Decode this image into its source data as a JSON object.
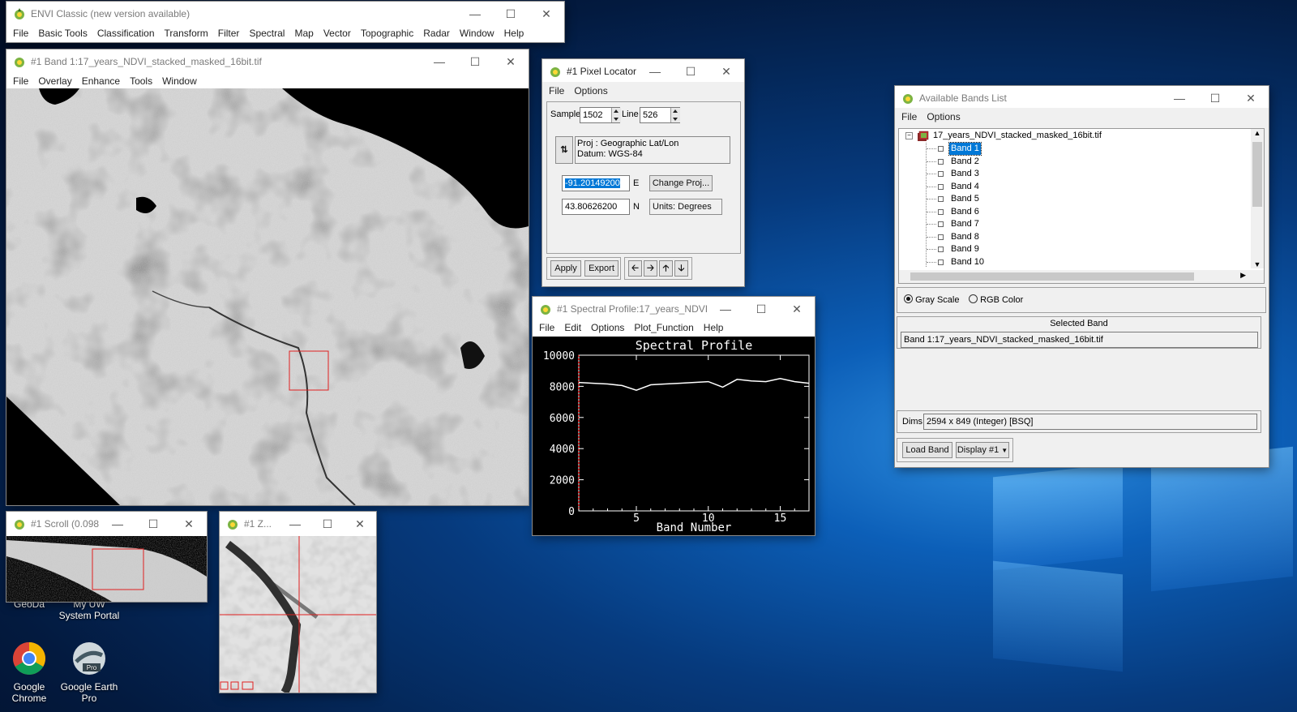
{
  "envi_main": {
    "title": "ENVI Classic (new version available)",
    "menu": [
      "File",
      "Basic Tools",
      "Classification",
      "Transform",
      "Filter",
      "Spectral",
      "Map",
      "Vector",
      "Topographic",
      "Radar",
      "Window",
      "Help"
    ]
  },
  "image_window": {
    "title": "#1 Band 1:17_years_NDVI_stacked_masked_16bit.tif",
    "menu": [
      "File",
      "Overlay",
      "Enhance",
      "Tools",
      "Window"
    ]
  },
  "pixel_locator": {
    "title": "#1 Pixel Locator",
    "menu": [
      "File",
      "Options"
    ],
    "sample_label": "Sample",
    "sample_value": "1502",
    "line_label": "Line",
    "line_value": "526",
    "proj_line1": "Proj : Geographic Lat/Lon",
    "proj_line2": "Datum: WGS-84",
    "easting_value": "-91.20149200",
    "easting_unit": "E",
    "northing_value": "43.80626200",
    "northing_unit": "N",
    "change_proj": "Change Proj...",
    "units": "Units: Degrees",
    "apply": "Apply",
    "export": "Export"
  },
  "spectral_profile": {
    "title": "#1 Spectral Profile:17_years_NDVI_...",
    "menu": [
      "File",
      "Edit",
      "Options",
      "Plot_Function",
      "Help"
    ]
  },
  "chart_data": {
    "type": "line",
    "title": "Spectral Profile",
    "xlabel": "Band Number",
    "ylabel": "",
    "x": [
      1,
      2,
      3,
      4,
      5,
      6,
      7,
      8,
      9,
      10,
      11,
      12,
      13,
      14,
      15,
      16,
      17
    ],
    "series": [
      {
        "values": [
          8250,
          8200,
          8150,
          8050,
          7750,
          8100,
          8150,
          8200,
          8250,
          8300,
          7950,
          8450,
          8350,
          8300,
          8500,
          8300,
          8200
        ]
      }
    ],
    "xlim": [
      1,
      17
    ],
    "ylim": [
      0,
      10000
    ],
    "xticks": [
      "5",
      "10",
      "15"
    ],
    "yticks": [
      "0",
      "2000",
      "4000",
      "6000",
      "8000",
      "10000"
    ],
    "colors": {
      "background": "#000000",
      "line": "#ffffff",
      "axis": "#ffffff",
      "left_marker": "#ff2020"
    }
  },
  "bands_list": {
    "title": "Available Bands List",
    "menu": [
      "File",
      "Options"
    ],
    "file_node": "17_years_NDVI_stacked_masked_16bit.tif",
    "bands": [
      "Band 1",
      "Band 2",
      "Band 3",
      "Band 4",
      "Band 5",
      "Band 6",
      "Band 7",
      "Band 8",
      "Band 9",
      "Band 10"
    ],
    "selected_index": 0,
    "gray_scale": "Gray Scale",
    "rgb_color": "RGB Color",
    "selected_band_header": "Selected Band",
    "selected_band_value": "Band 1:17_years_NDVI_stacked_masked_16bit.tif",
    "dims_label": "Dims",
    "dims_value": "2594 x 849 (Integer) [BSQ]",
    "load_band": "Load Band",
    "display": "Display #1"
  },
  "scroll_window": {
    "title": "#1 Scroll (0.098..."
  },
  "zoom_window": {
    "title": "#1 Z..."
  },
  "desktop_icons": [
    {
      "label": "GeoDa"
    },
    {
      "label": "My UW System Portal"
    },
    {
      "label": "Google Chrome"
    },
    {
      "label": "Google Earth Pro"
    }
  ],
  "colors": {
    "accent_blue": "#0078d7",
    "roi_red": "#e02020"
  }
}
